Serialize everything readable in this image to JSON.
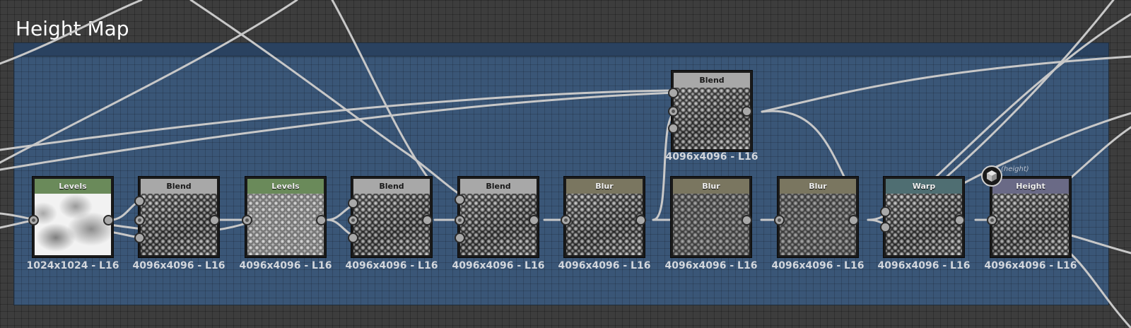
{
  "frame": {
    "title": "Height Map"
  },
  "output": {
    "caption": "(height)"
  },
  "nodes": [
    {
      "id": "levels-1",
      "title": "Levels",
      "color": "#6a8a5a",
      "resolution": "1024x1024 - L16"
    },
    {
      "id": "blend-1",
      "title": "Blend",
      "color": "#a8a8a8",
      "resolution": "4096x4096 - L16"
    },
    {
      "id": "levels-2",
      "title": "Levels",
      "color": "#6a8a5a",
      "resolution": "4096x4096 - L16"
    },
    {
      "id": "blend-2",
      "title": "Blend",
      "color": "#a8a8a8",
      "resolution": "4096x4096 - L16"
    },
    {
      "id": "blend-3",
      "title": "Blend",
      "color": "#a8a8a8",
      "resolution": "4096x4096 - L16"
    },
    {
      "id": "blur-1",
      "title": "Blur",
      "color": "#7a7660",
      "resolution": "4096x4096 - L16"
    },
    {
      "id": "blur-2",
      "title": "Blur",
      "color": "#7a7660",
      "resolution": "4096x4096 - L16"
    },
    {
      "id": "blur-3",
      "title": "Blur",
      "color": "#7a7660",
      "resolution": "4096x4096 - L16"
    },
    {
      "id": "warp-1",
      "title": "Warp",
      "color": "#4f6e72",
      "resolution": "4096x4096 - L16"
    },
    {
      "id": "height-1",
      "title": "Height",
      "color": "#6a6a86",
      "resolution": "4096x4096 - L16"
    },
    {
      "id": "blend-top",
      "title": "Blend",
      "color": "#a8a8a8",
      "resolution": "4096x4096 - L16"
    }
  ],
  "colors": {
    "canvas_bg": "#3d3d3d",
    "frame_bg": "#3a5677",
    "wire": "#c8c8c8",
    "header_levels": "#6a8a5a",
    "header_blend": "#a8a8a8",
    "header_blur": "#7a7660",
    "header_warp": "#4f6e72",
    "header_height": "#6a6a86"
  },
  "icons": {
    "output": "cube-icon"
  }
}
